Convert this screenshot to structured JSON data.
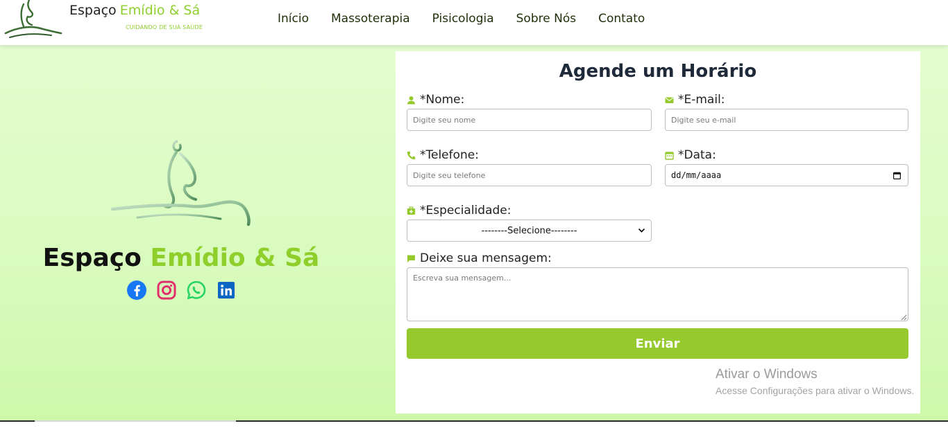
{
  "header": {
    "brand_part1": "Espaço",
    "brand_part2": "Emídio & Sá",
    "tagline": "CUIDANDO DE SUA SAÚDE",
    "nav": [
      "Início",
      "Massoterapia",
      "Pisicologia",
      "Sobre Nós",
      "Contato"
    ]
  },
  "hero": {
    "brand_part1": "Espaço",
    "brand_part2": "Emídio & Sá",
    "socials": [
      "facebook-icon",
      "instagram-icon",
      "whatsapp-icon",
      "linkedin-icon"
    ]
  },
  "form": {
    "title": "Agende um Horário",
    "name_label": "*Nome:",
    "name_placeholder": "Digite seu nome",
    "email_label": "*E-mail:",
    "email_placeholder": "Digite seu e-mail",
    "phone_label": "*Telefone:",
    "phone_placeholder": "Digite seu telefone",
    "date_label": "*Data:",
    "date_value": "dd/mm/aaaa",
    "specialty_label": "*Especialidade:",
    "specialty_selected": "--------Selecione--------",
    "message_label": "Deixe sua mensagem:",
    "message_placeholder": "Escreva sua mensagem...",
    "submit_label": "Enviar"
  },
  "watermark": {
    "line1": "Ativar o Windows",
    "line2": "Acesse Configurações para ativar o Windows."
  },
  "colors": {
    "accent_green": "#95c92d",
    "brand_green": "#8ecf2c",
    "background_green": "#d8fbbd",
    "facebook": "#1877f2",
    "instagram": "#e1306c",
    "whatsapp": "#25d366",
    "linkedin": "#0a66c2"
  }
}
